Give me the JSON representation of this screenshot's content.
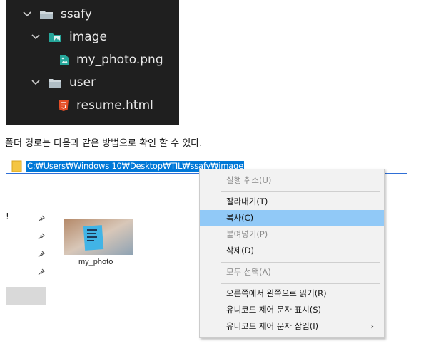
{
  "tree": {
    "items": [
      {
        "label": "ssafy",
        "type": "folder",
        "expanded": true
      },
      {
        "label": "image",
        "type": "image-folder",
        "expanded": true
      },
      {
        "label": "my_photo.png",
        "type": "png-file"
      },
      {
        "label": "user",
        "type": "folder",
        "expanded": true
      },
      {
        "label": "resume.html",
        "type": "html-file"
      }
    ]
  },
  "caption": "폴더 경로는 다음과 같은 방법으로 확인 할 수 있다.",
  "address_bar": {
    "path": "C:₩Users₩Windows 10₩Desktop₩TIL₩ssafy₩image"
  },
  "nav": {
    "truncated_label": "!"
  },
  "file": {
    "name": "my_photo"
  },
  "context_menu": {
    "items": [
      {
        "label": "실행 취소(U)",
        "disabled": true
      },
      {
        "label": "잘라내기(T)"
      },
      {
        "label": "복사(C)",
        "highlighted": true
      },
      {
        "label": "붙여넣기(P)",
        "disabled": true
      },
      {
        "label": "삭제(D)"
      },
      {
        "label": "모두 선택(A)",
        "disabled": true
      },
      {
        "label": "오른쪽에서 왼쪽으로 읽기(R)"
      },
      {
        "label": "유니코드 제어 문자 표시(S)"
      },
      {
        "label": "유니코드 제어 문자 삽입(I)",
        "submenu_arrow": "›"
      }
    ]
  },
  "colors": {
    "tree_bg": "#1f1f1f",
    "folder_icon": "#cfd8dc",
    "image_folder_icon": "#26a69a",
    "png_icon": "#26a69a",
    "html_icon": "#e44d26",
    "selection": "#0078d7",
    "menu_highlight": "#91c9f7"
  }
}
